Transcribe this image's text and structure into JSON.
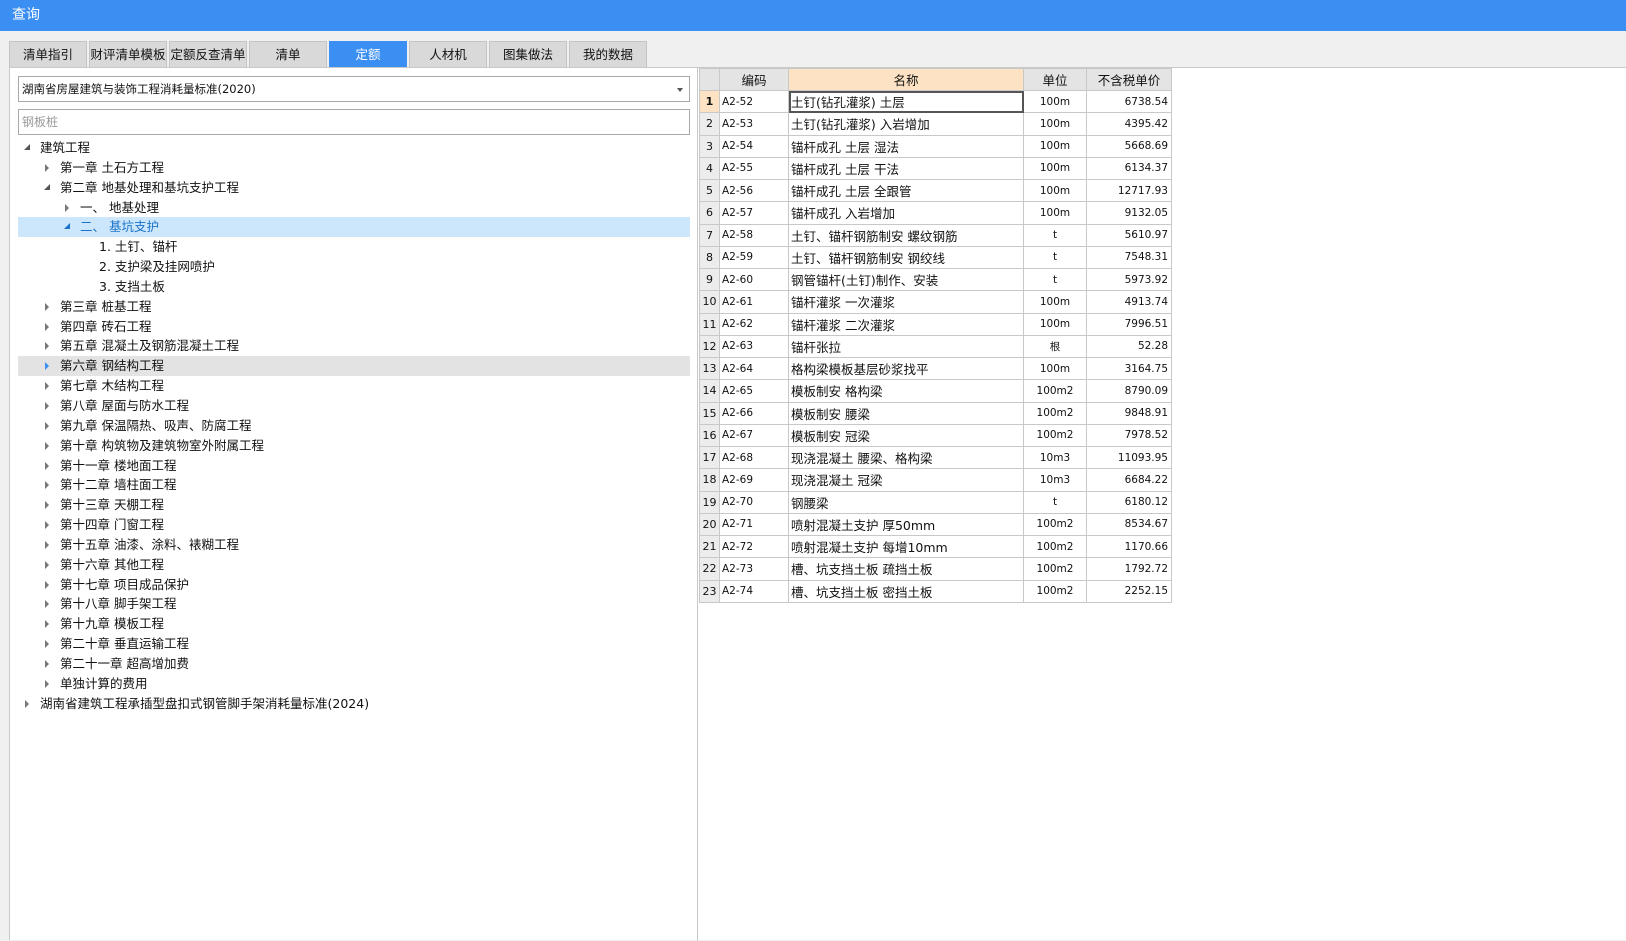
{
  "window": {
    "title": "查询"
  },
  "tabs": [
    {
      "label": "清单指引",
      "active": false
    },
    {
      "label": "财评清单模板",
      "active": false
    },
    {
      "label": "定额反查清单",
      "active": false
    },
    {
      "label": "清单",
      "active": false
    },
    {
      "label": "定额",
      "active": true
    },
    {
      "label": "人材机",
      "active": false
    },
    {
      "label": "图集做法",
      "active": false
    },
    {
      "label": "我的数据",
      "active": false
    }
  ],
  "library_select": {
    "value": "湖南省房屋建筑与装饰工程消耗量标准(2020)"
  },
  "search": {
    "value": "",
    "placeholder": "钢板桩"
  },
  "tree": [
    {
      "label": "建筑工程",
      "level": 0,
      "state": "expanded"
    },
    {
      "label": "第一章 土石方工程",
      "level": 1,
      "state": "collapsed"
    },
    {
      "label": "第二章 地基处理和基坑支护工程",
      "level": 1,
      "state": "expanded"
    },
    {
      "label": "一、 地基处理",
      "level": 2,
      "state": "collapsed"
    },
    {
      "label": "二、 基坑支护",
      "level": 2,
      "state": "expanded",
      "selected": true
    },
    {
      "label": "1. 土钉、锚杆",
      "level": 3,
      "state": "leaf"
    },
    {
      "label": "2. 支护梁及挂网喷护",
      "level": 3,
      "state": "leaf"
    },
    {
      "label": "3. 支挡土板",
      "level": 3,
      "state": "leaf"
    },
    {
      "label": "第三章 桩基工程",
      "level": 1,
      "state": "collapsed"
    },
    {
      "label": "第四章 砖石工程",
      "level": 1,
      "state": "collapsed"
    },
    {
      "label": "第五章 混凝土及钢筋混凝土工程",
      "level": 1,
      "state": "collapsed"
    },
    {
      "label": "第六章 钢结构工程",
      "level": 1,
      "state": "collapsed",
      "hover": true
    },
    {
      "label": "第七章 木结构工程",
      "level": 1,
      "state": "collapsed"
    },
    {
      "label": "第八章 屋面与防水工程",
      "level": 1,
      "state": "collapsed"
    },
    {
      "label": "第九章 保温隔热、吸声、防腐工程",
      "level": 1,
      "state": "collapsed"
    },
    {
      "label": "第十章 构筑物及建筑物室外附属工程",
      "level": 1,
      "state": "collapsed"
    },
    {
      "label": "第十一章 楼地面工程",
      "level": 1,
      "state": "collapsed"
    },
    {
      "label": "第十二章 墙柱面工程",
      "level": 1,
      "state": "collapsed"
    },
    {
      "label": "第十三章 天棚工程",
      "level": 1,
      "state": "collapsed"
    },
    {
      "label": "第十四章 门窗工程",
      "level": 1,
      "state": "collapsed"
    },
    {
      "label": "第十五章 油漆、涂料、裱糊工程",
      "level": 1,
      "state": "collapsed"
    },
    {
      "label": "第十六章 其他工程",
      "level": 1,
      "state": "collapsed"
    },
    {
      "label": "第十七章 项目成品保护",
      "level": 1,
      "state": "collapsed"
    },
    {
      "label": "第十八章 脚手架工程",
      "level": 1,
      "state": "collapsed"
    },
    {
      "label": "第十九章 模板工程",
      "level": 1,
      "state": "collapsed"
    },
    {
      "label": "第二十章 垂直运输工程",
      "level": 1,
      "state": "collapsed"
    },
    {
      "label": "第二十一章 超高增加费",
      "level": 1,
      "state": "collapsed"
    },
    {
      "label": "单独计算的费用",
      "level": 1,
      "state": "collapsed"
    },
    {
      "label": "湖南省建筑工程承插型盘扣式钢管脚手架消耗量标准(2024)",
      "level": 0,
      "state": "collapsed"
    }
  ],
  "table": {
    "columns": [
      "",
      "编码",
      "名称",
      "单位",
      "不含税单价"
    ],
    "current_row": 1,
    "rows": [
      {
        "n": "1",
        "code": "A2-52",
        "name": "土钉(钻孔灌浆) 土层",
        "unit": "100m",
        "price": "6738.54"
      },
      {
        "n": "2",
        "code": "A2-53",
        "name": "土钉(钻孔灌浆) 入岩增加",
        "unit": "100m",
        "price": "4395.42"
      },
      {
        "n": "3",
        "code": "A2-54",
        "name": "锚杆成孔 土层 湿法",
        "unit": "100m",
        "price": "5668.69"
      },
      {
        "n": "4",
        "code": "A2-55",
        "name": "锚杆成孔 土层 干法",
        "unit": "100m",
        "price": "6134.37"
      },
      {
        "n": "5",
        "code": "A2-56",
        "name": "锚杆成孔 土层 全跟管",
        "unit": "100m",
        "price": "12717.93"
      },
      {
        "n": "6",
        "code": "A2-57",
        "name": "锚杆成孔 入岩增加",
        "unit": "100m",
        "price": "9132.05"
      },
      {
        "n": "7",
        "code": "A2-58",
        "name": "土钉、锚杆钢筋制安 螺纹钢筋",
        "unit": "t",
        "price": "5610.97"
      },
      {
        "n": "8",
        "code": "A2-59",
        "name": "土钉、锚杆钢筋制安 钢绞线",
        "unit": "t",
        "price": "7548.31"
      },
      {
        "n": "9",
        "code": "A2-60",
        "name": "钢管锚杆(土钉)制作、安装",
        "unit": "t",
        "price": "5973.92"
      },
      {
        "n": "10",
        "code": "A2-61",
        "name": "锚杆灌浆 一次灌浆",
        "unit": "100m",
        "price": "4913.74"
      },
      {
        "n": "11",
        "code": "A2-62",
        "name": "锚杆灌浆 二次灌浆",
        "unit": "100m",
        "price": "7996.51"
      },
      {
        "n": "12",
        "code": "A2-63",
        "name": "锚杆张拉",
        "unit": "根",
        "price": "52.28"
      },
      {
        "n": "13",
        "code": "A2-64",
        "name": "格构梁模板基层砂浆找平",
        "unit": "100m",
        "price": "3164.75"
      },
      {
        "n": "14",
        "code": "A2-65",
        "name": "模板制安 格构梁",
        "unit": "100m2",
        "price": "8790.09"
      },
      {
        "n": "15",
        "code": "A2-66",
        "name": "模板制安 腰梁",
        "unit": "100m2",
        "price": "9848.91"
      },
      {
        "n": "16",
        "code": "A2-67",
        "name": "模板制安 冠梁",
        "unit": "100m2",
        "price": "7978.52"
      },
      {
        "n": "17",
        "code": "A2-68",
        "name": "现浇混凝土 腰梁、格构梁",
        "unit": "10m3",
        "price": "11093.95"
      },
      {
        "n": "18",
        "code": "A2-69",
        "name": "现浇混凝土 冠梁",
        "unit": "10m3",
        "price": "6684.22"
      },
      {
        "n": "19",
        "code": "A2-70",
        "name": "钢腰梁",
        "unit": "t",
        "price": "6180.12"
      },
      {
        "n": "20",
        "code": "A2-71",
        "name": "喷射混凝土支护 厚50mm",
        "unit": "100m2",
        "price": "8534.67"
      },
      {
        "n": "21",
        "code": "A2-72",
        "name": "喷射混凝土支护 每增10mm",
        "unit": "100m2",
        "price": "1170.66"
      },
      {
        "n": "22",
        "code": "A2-73",
        "name": "槽、坑支挡土板 疏挡土板",
        "unit": "100m2",
        "price": "1792.72"
      },
      {
        "n": "23",
        "code": "A2-74",
        "name": "槽、坑支挡土板 密挡土板",
        "unit": "100m2",
        "price": "2252.15"
      }
    ]
  }
}
